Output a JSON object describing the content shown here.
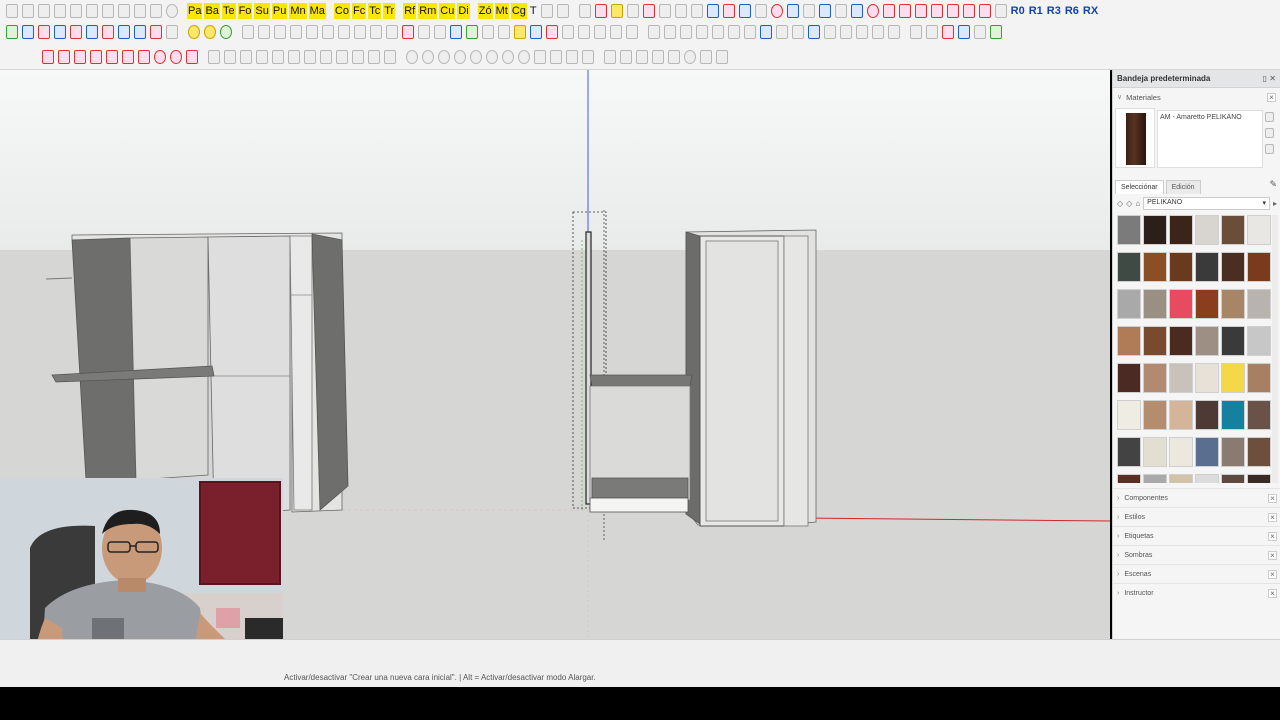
{
  "toolbar": {
    "row1_tags_a": [
      "Pa",
      "Ba",
      "Te",
      "Fo",
      "Su",
      "Pu",
      "Mn",
      "Ma"
    ],
    "row1_tags_b": [
      "Co",
      "Fc",
      "Tc",
      "Tr"
    ],
    "row1_tags_c": [
      "Rf",
      "Rm",
      "Cu",
      "Di"
    ],
    "row1_tags_d": [
      "Zó",
      "Mt",
      "Cg"
    ],
    "row1_tags_e": [
      "T"
    ],
    "row1_right_tags": [
      "R0",
      "R1",
      "R3",
      "R6",
      "RX"
    ]
  },
  "tray": {
    "title": "Bandeja predeterminada",
    "materials_label": "Materiales",
    "material_name": "AM - Amaretto PELIKANO",
    "tab_select": "Selecciónar",
    "tab_edit": "Edición",
    "library": "PELIKANO",
    "swatches": [
      "#7b7b7b",
      "#2b1f1a",
      "#3b2419",
      "#d8d5d0",
      "#6b4e3a",
      "#e9e7e4",
      "#3f4a44",
      "#8a4f24",
      "#6a3a1e",
      "#3a3a3a",
      "#4a2e22",
      "#7a3a1c",
      "#a9a9a9",
      "#9a8f83",
      "#e84a5f",
      "#8b3e1e",
      "#a88566",
      "#b8b3ad",
      "#b07c58",
      "#7a4a2e",
      "#4b2b1f",
      "#9e8f84",
      "#3a3a3a",
      "#c7c7c7",
      "#4a2a22",
      "#b28a72",
      "#c9c2ba",
      "#e6e2d8",
      "#f5d848",
      "#a77f62",
      "#efece4",
      "#b48c6e",
      "#d4b59a",
      "#4d3a34",
      "#1680a0",
      "#6a5248",
      "#434343",
      "#e3ded2",
      "#ece8de",
      "#5a6f8f",
      "#8a7a70",
      "#6e4e3c",
      "#5a2e24",
      "#a9a9a9",
      "#d1c4a6",
      "#dcdcdc",
      "#5c4a40",
      "#3a2a26"
    ],
    "panels": [
      "Componentes",
      "Estilos",
      "Etiquetas",
      "Sombras",
      "Escenas",
      "Instructor"
    ]
  },
  "status": {
    "text": "Activar/desactivar \"Crear una nueva cara inicial\". | Alt = Activar/desactivar modo Alargar."
  }
}
